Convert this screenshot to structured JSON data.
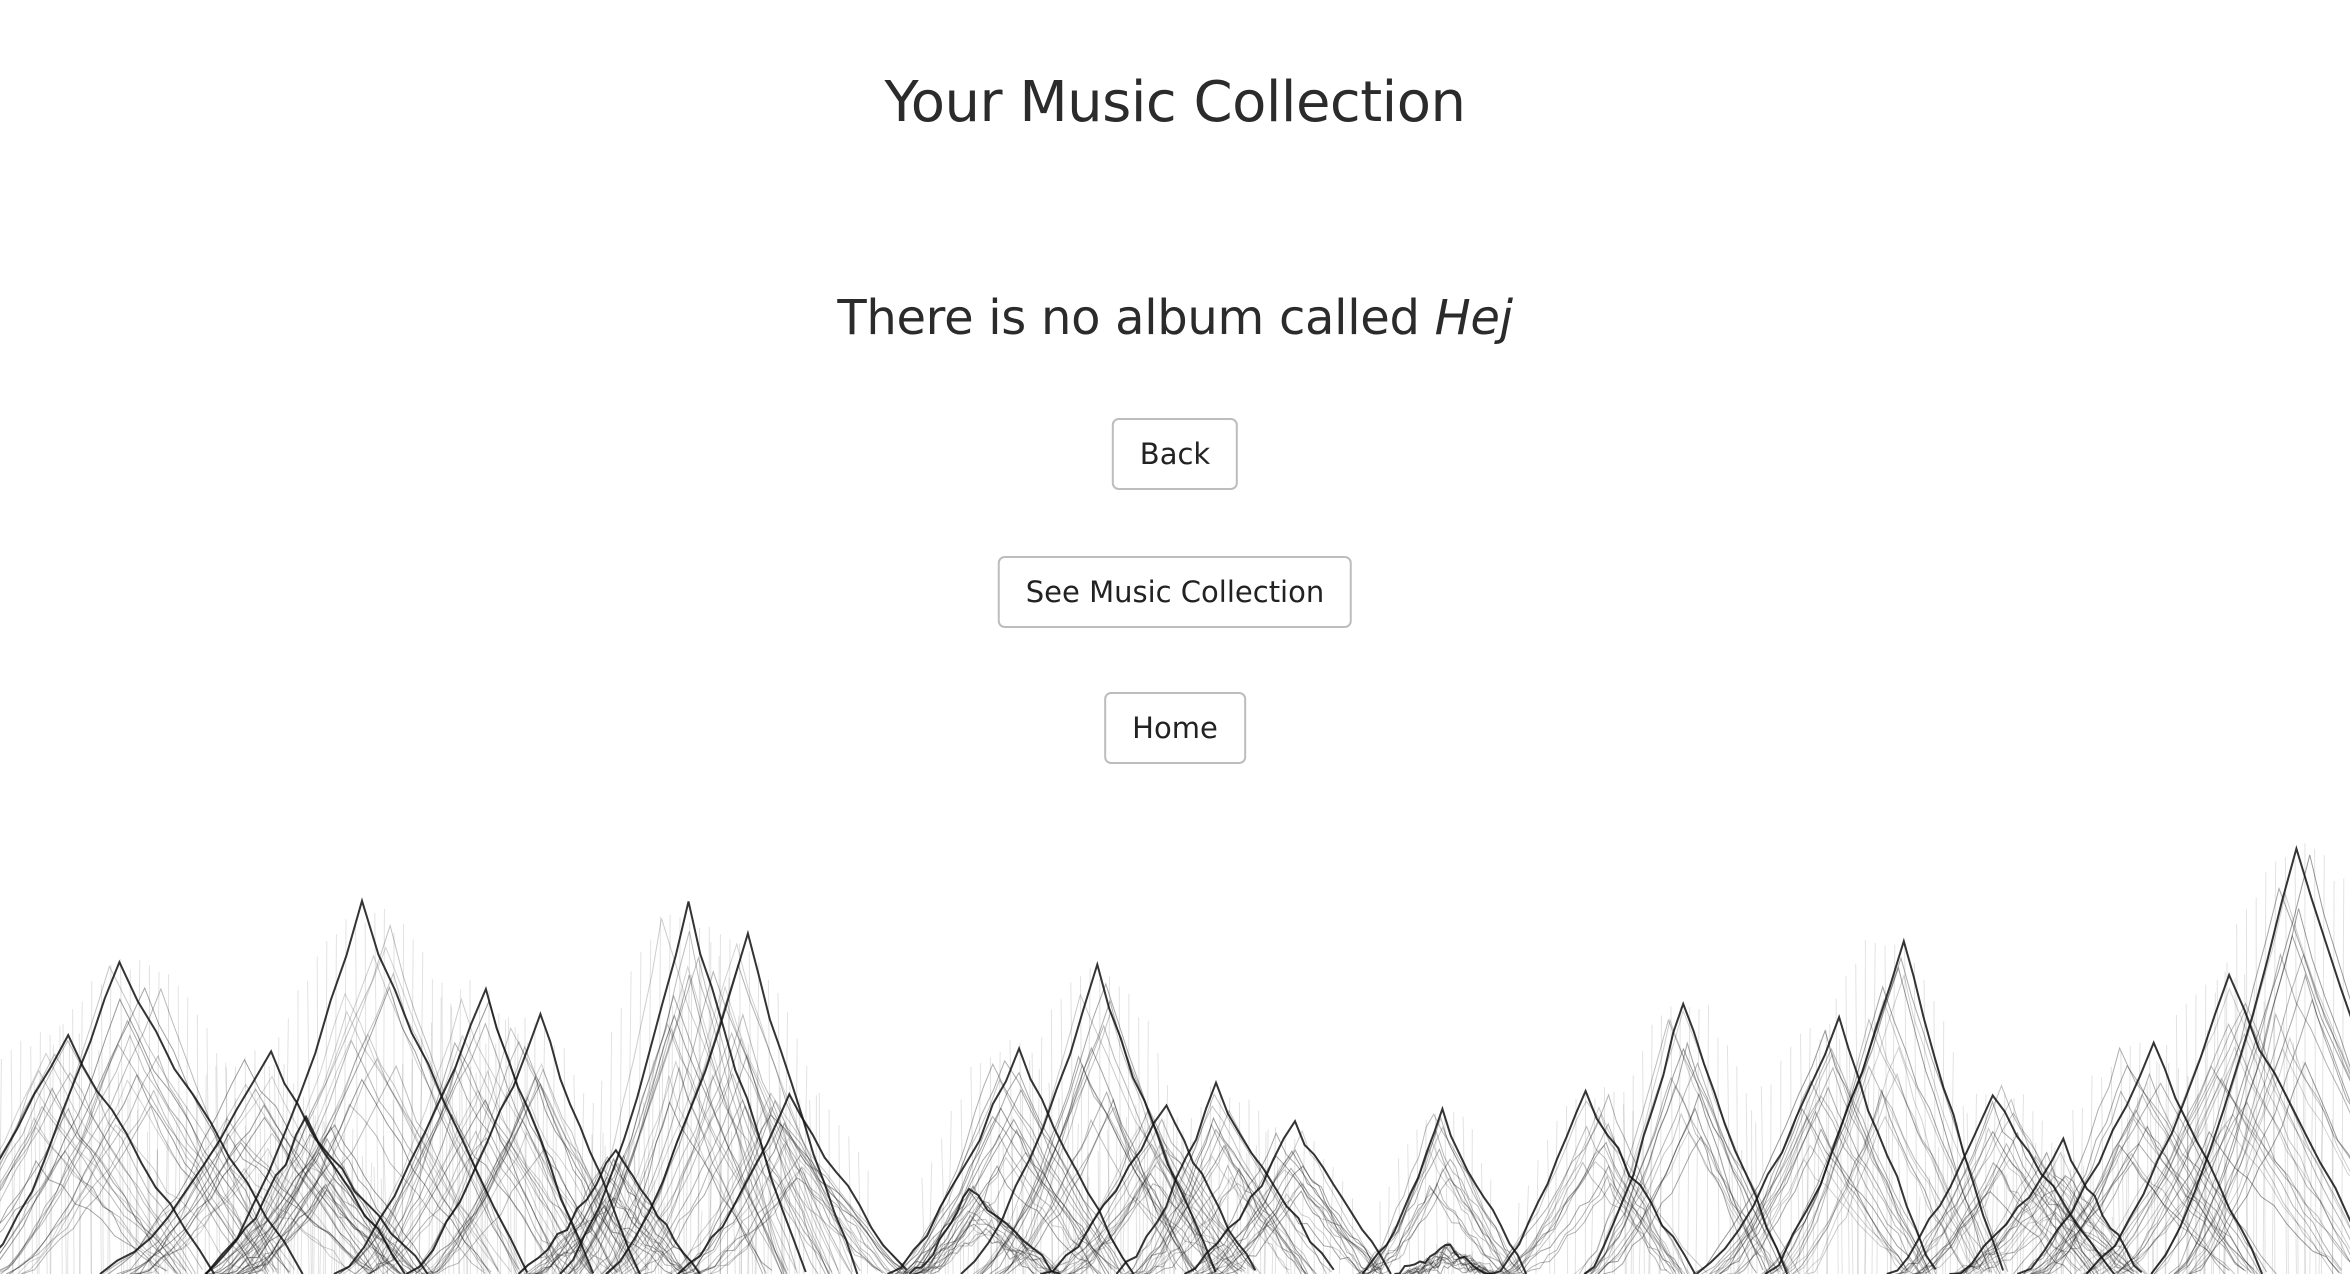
{
  "header": {
    "title": "Your Music Collection"
  },
  "main": {
    "message_prefix": "There is no album called",
    "album_name": "Hej",
    "buttons": {
      "back": "Back",
      "see_collection": "See Music Collection",
      "home": "Home"
    }
  },
  "colors": {
    "text": "#2b2b2b",
    "button_border": "#bdbdbd",
    "background": "#ffffff",
    "landscape_stroke": "#111111"
  }
}
